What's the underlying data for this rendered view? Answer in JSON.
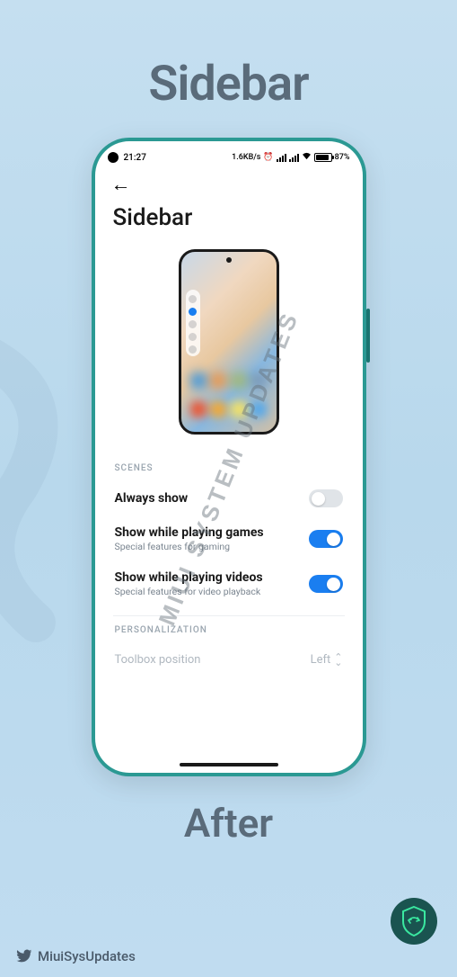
{
  "top_title": "Sidebar",
  "bottom_title": "After",
  "watermark": "MIUI SYSTEM UPDATES",
  "credit_handle": "MiuiSysUpdates",
  "status": {
    "time": "21:27",
    "net_speed": "1.6KB/s",
    "battery_pct": "87%"
  },
  "page": {
    "title": "Sidebar",
    "sections": {
      "scenes_label": "SCENES",
      "personalization_label": "PERSONALIZATION"
    },
    "settings": [
      {
        "title": "Always show",
        "sub": "",
        "on": false
      },
      {
        "title": "Show while playing games",
        "sub": "Special features for gaming",
        "on": true
      },
      {
        "title": "Show while playing videos",
        "sub": "Special features for video playback",
        "on": true
      }
    ],
    "toolbox_position": {
      "label": "Toolbox position",
      "value": "Left"
    }
  }
}
